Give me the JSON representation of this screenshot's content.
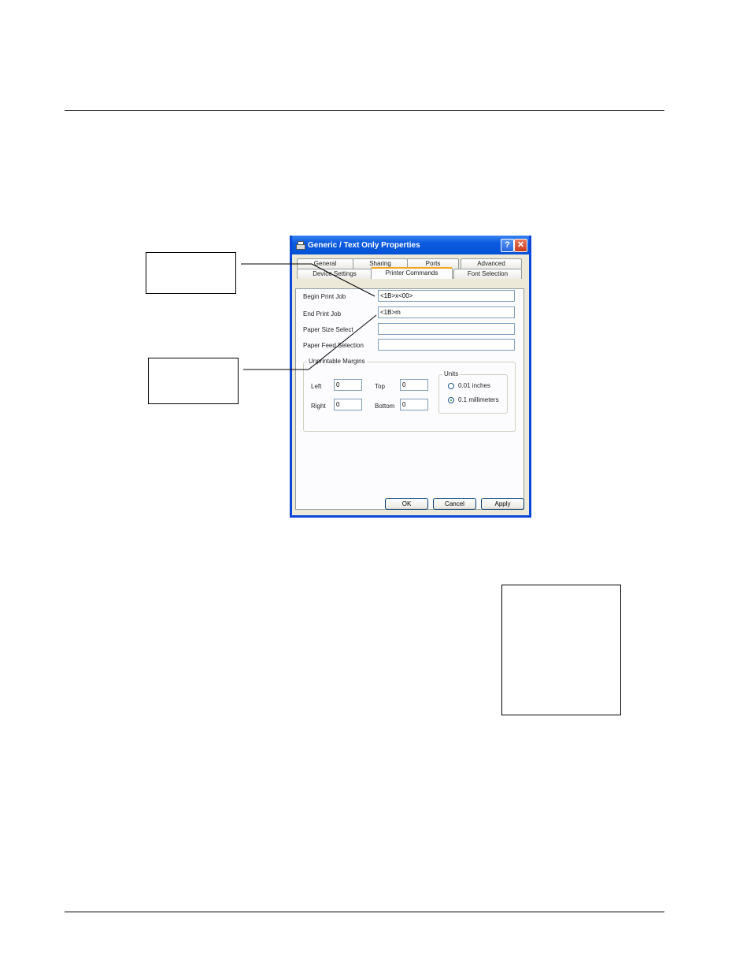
{
  "dialog": {
    "title": "Generic / Text Only Properties",
    "help_label": "?",
    "close_label": "✕",
    "tabs_row1": [
      "General",
      "Sharing",
      "Ports",
      "Advanced"
    ],
    "tabs_row2": [
      "Device Settings",
      "Printer Commands",
      "Font Selection"
    ],
    "active_tab": "Printer Commands",
    "fields": {
      "begin_label": "Begin Print Job",
      "begin_value": "<1B>x<00>",
      "end_label": "End Print Job",
      "end_value": "<1B>m",
      "paper_size_label": "Paper Size Select",
      "paper_size_value": "",
      "paper_feed_label": "Paper Feed Selection",
      "paper_feed_value": ""
    },
    "margins": {
      "caption": "Unprintable Margins",
      "left_label": "Left",
      "left_value": "0",
      "top_label": "Top",
      "top_value": "0",
      "right_label": "Right",
      "right_value": "0",
      "bottom_label": "Bottom",
      "bottom_value": "0"
    },
    "units": {
      "caption": "Units",
      "option1": "0.01 inches",
      "option2": "0.1 millimeters",
      "selected": "0.1 millimeters"
    },
    "buttons": {
      "ok": "OK",
      "cancel": "Cancel",
      "apply": "Apply"
    }
  }
}
